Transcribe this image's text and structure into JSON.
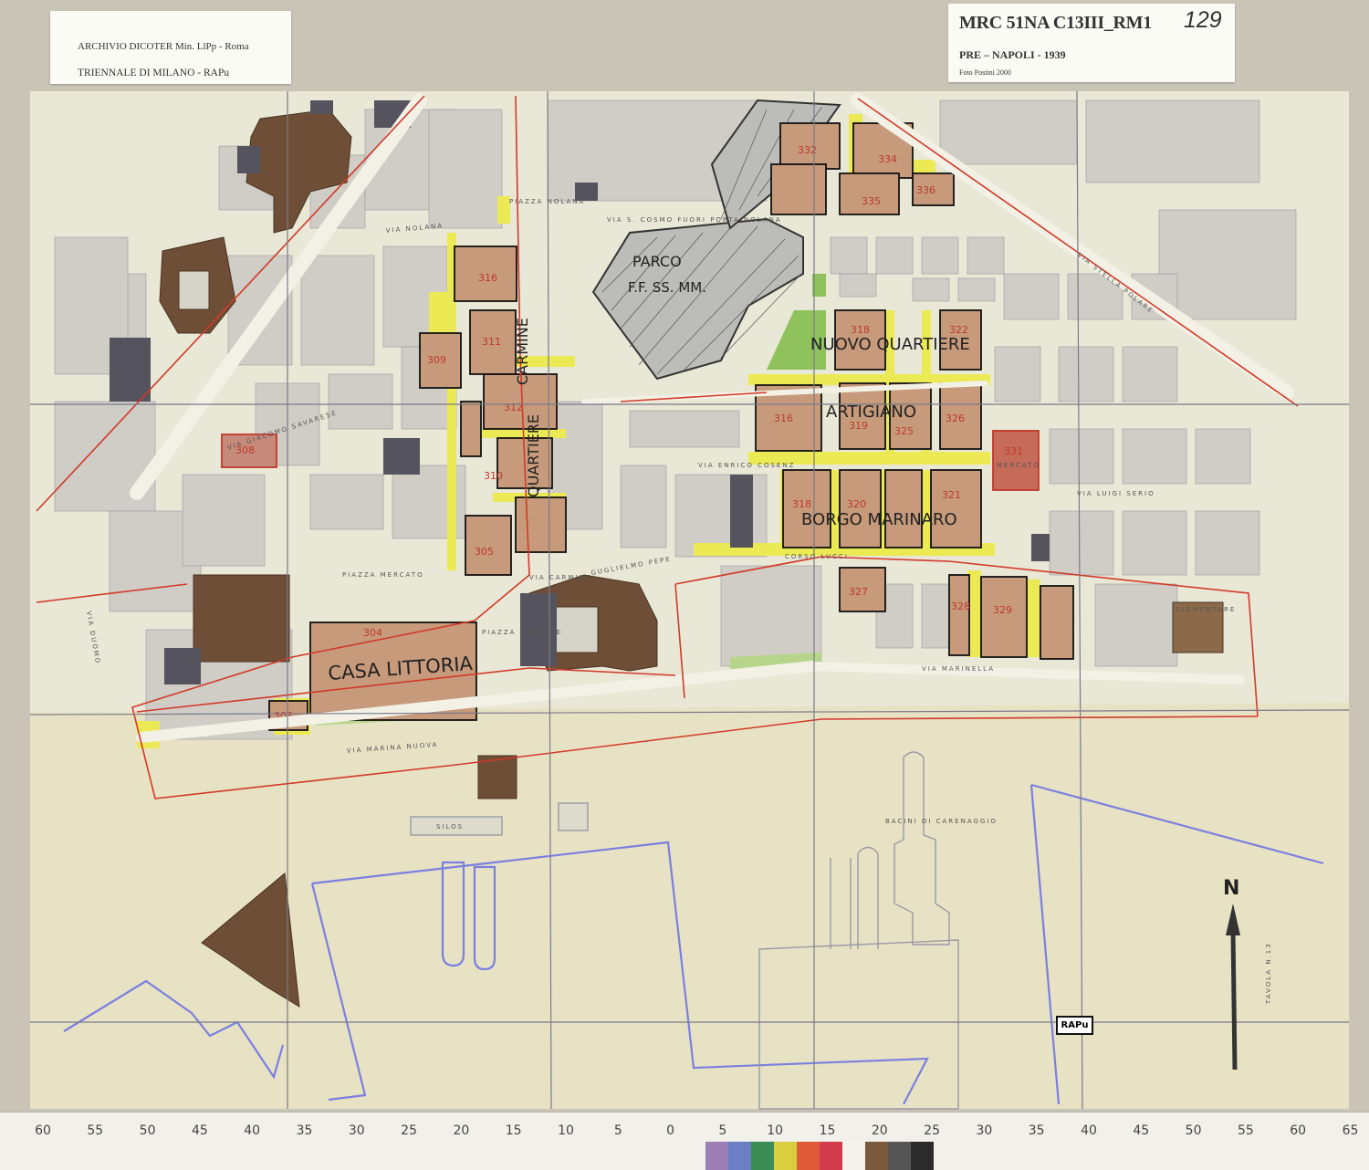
{
  "labels": {
    "archive": "ARCHIVIO DICOTER Min. LlPp - Roma",
    "triennale": "TRIENNALE DI MILANO - RAPu",
    "code": "MRC 51NA C13III_RM1",
    "sheet_number": "129",
    "place_year": "PRE – NAPOLI - 1939",
    "photo_credit": "Foto Postini 2000",
    "stamp": "RAPu",
    "north": "N"
  },
  "districts": {
    "parco": "PARCO",
    "ffss": "F.F. SS. MM.",
    "nuovo_quartiere": "NUOVO QUARTIERE",
    "artigiano": "ARTIGIANO",
    "borgo_marinaro": "BORGO MARINARO",
    "casa_littoria": "CASA LITTORIA",
    "quartiere": "QUARTIERE",
    "carmine": "CARMINE"
  },
  "streets": {
    "via_nolana": "VIA NOLANA",
    "via_cosmo": "VIA S. COSMO FUORI PORTA NOLANA",
    "via_cosenz": "VIA ENRICO COSENZ",
    "piazza_mercato": "PIAZZA MERCATO",
    "via_marina_nuova": "VIA MARINA NUOVA",
    "via_marinella": "VIA MARINELLA",
    "piazza_carmine": "PIAZZA CARMINE",
    "via_carmine": "VIA CARMINE",
    "via_pepe": "GUGLIELMO PEPE",
    "piazza_nolana": "PIAZZA NOLANA",
    "via_giacomo_savarese": "VIA GIACOMO SAVARESE",
    "via_duomo": "VIA DUOMO",
    "silos": "SILOS",
    "bacini": "BACINI DI CARENAGGIO",
    "via_stella_polare": "VIA STELLA POLARE",
    "corso_lucci": "CORSO LUCCI",
    "tavola": "TAVOLA N.13",
    "mercato": "MERCATO",
    "elementare": "ELEMENTARE",
    "via_luigi_serio": "VIA LUIGI SERIO"
  },
  "block_numbers": [
    "332",
    "334",
    "335",
    "336",
    "316",
    "311",
    "309",
    "312",
    "310",
    "305",
    "318",
    "322",
    "316",
    "319",
    "325",
    "326",
    "331",
    "318",
    "320",
    "321",
    "327",
    "328",
    "329",
    "304",
    "303",
    "308"
  ],
  "ruler": {
    "ticks": [
      "60",
      "55",
      "50",
      "45",
      "40",
      "35",
      "30",
      "25",
      "20",
      "15",
      "10",
      "5",
      "0",
      "5",
      "10",
      "15",
      "20",
      "25",
      "30",
      "35",
      "40",
      "45",
      "50",
      "55",
      "60",
      "65"
    ],
    "swatches": [
      "#9d7fb6",
      "#6a7fc4",
      "#3c8d55",
      "#d9cf3e",
      "#e05b3a",
      "#d33a4c",
      "#f4f2ea",
      "#7a5a3a",
      "#555555",
      "#2b2b2b"
    ]
  }
}
